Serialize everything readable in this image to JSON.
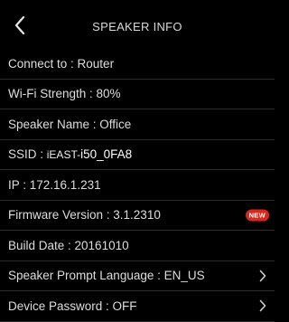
{
  "header": {
    "title": "SPEAKER INFO",
    "back_icon": "chevron-left-icon"
  },
  "rows": {
    "connect": "Connect to : Router",
    "wifi": "Wi-Fi Strength : 80%",
    "speaker_name": "Speaker Name : Office",
    "ssid_label": "SSID : ",
    "ssid_prefix": "iEAST-",
    "ssid_value": "i50_0FA8",
    "ip": "IP : 172.16.1.231",
    "firmware": "Firmware Version : 3.1.2310",
    "firmware_badge": "NEW",
    "build_date": "Build Date : 20161010",
    "prompt_language": "Speaker Prompt Language : EN_US",
    "device_password": "Device Password : OFF"
  },
  "colors": {
    "background": "#000000",
    "text": "#dedede",
    "badge": "#d8271d",
    "divider": "#2b2b2b"
  }
}
